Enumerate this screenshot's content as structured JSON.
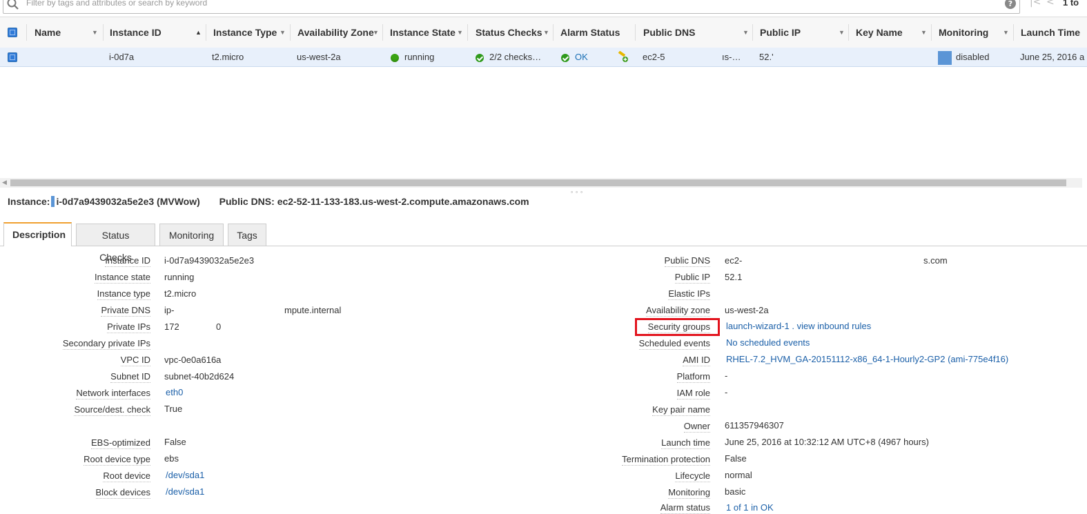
{
  "filter": {
    "placeholder": "Filter by tags and attributes or search by keyword",
    "pager_text": "1 to"
  },
  "grid": {
    "columns": [
      {
        "label": "Name"
      },
      {
        "label": "Instance ID"
      },
      {
        "label": "Instance Type"
      },
      {
        "label": "Availability Zone"
      },
      {
        "label": "Instance State"
      },
      {
        "label": "Status Checks"
      },
      {
        "label": "Alarm Status"
      },
      {
        "label": "Public DNS"
      },
      {
        "label": "Public IP"
      },
      {
        "label": "Key Name"
      },
      {
        "label": "Monitoring"
      },
      {
        "label": "Launch Time"
      }
    ],
    "row": {
      "name": "",
      "instance_id": "i-0d7a",
      "instance_type": "t2.micro",
      "availability_zone": "us-west-2a",
      "instance_state": "running",
      "status_checks": "2/2 checks…",
      "alarm_status": "OK",
      "public_dns": "ec2-5",
      "public_dns_tail": "ıs-…",
      "public_ip": "52.'",
      "key_name": "",
      "monitoring": "disabled",
      "launch_time": "June 25, 2016 a"
    }
  },
  "detail": {
    "instance_label": "Instance:",
    "instance_value": "i-0d7a9439032a5e2e3 (MVWow)",
    "public_dns_label": "Public DNS:",
    "public_dns_value": "ec2-52-11-133-183.us-west-2.compute.amazonaws.com"
  },
  "tabs": [
    {
      "label": "Description"
    },
    {
      "label": "Status Checks"
    },
    {
      "label": "Monitoring"
    },
    {
      "label": "Tags"
    }
  ],
  "description_left": [
    {
      "label": "Instance ID",
      "value": "i-0d7a9439032a5e2e3"
    },
    {
      "label": "Instance state",
      "value": "running"
    },
    {
      "label": "Instance type",
      "value": "t2.micro"
    },
    {
      "label": "Private DNS",
      "value": "ip-",
      "value2": "mpute.internal"
    },
    {
      "label": "Private IPs",
      "value": "172",
      "value2": "0"
    },
    {
      "label": "Secondary private IPs",
      "value": ""
    },
    {
      "label": "VPC ID",
      "value": "vpc-0e0a616a"
    },
    {
      "label": "Subnet ID",
      "value": "subnet-40b2d624"
    },
    {
      "label": "Network interfaces",
      "value": "eth0"
    },
    {
      "label": "Source/dest. check",
      "value": "True"
    },
    {
      "label": "EBS-optimized",
      "value": "False"
    },
    {
      "label": "Root device type",
      "value": "ebs"
    },
    {
      "label": "Root device",
      "value": "/dev/sda1"
    },
    {
      "label": "Block devices",
      "value": "/dev/sda1"
    }
  ],
  "description_right": [
    {
      "label": "Public DNS",
      "value": "ec2-",
      "value2": "s.com"
    },
    {
      "label": "Public IP",
      "value": "52.1"
    },
    {
      "label": "Elastic IPs",
      "value": ""
    },
    {
      "label": "Availability zone",
      "value": "us-west-2a"
    },
    {
      "label": "Security groups",
      "value": "launch-wizard-1 . view inbound rules"
    },
    {
      "label": "Scheduled events",
      "value": "No scheduled events"
    },
    {
      "label": "AMI ID",
      "value": "RHEL-7.2_HVM_GA-20151112-x86_64-1-Hourly2-GP2 (ami-775e4f16)"
    },
    {
      "label": "Platform",
      "value": "-"
    },
    {
      "label": "IAM role",
      "value": "-"
    },
    {
      "label": "Key pair name",
      "value": ""
    },
    {
      "label": "Owner",
      "value": "611357946307"
    },
    {
      "label": "Launch time",
      "value": "June 25, 2016 at 10:32:12 AM UTC+8 (4967 hours)"
    },
    {
      "label": "Termination protection",
      "value": "False"
    },
    {
      "label": "Lifecycle",
      "value": "normal"
    },
    {
      "label": "Monitoring",
      "value": "basic"
    },
    {
      "label": "Alarm status",
      "value": "1 of 1 in OK"
    }
  ]
}
